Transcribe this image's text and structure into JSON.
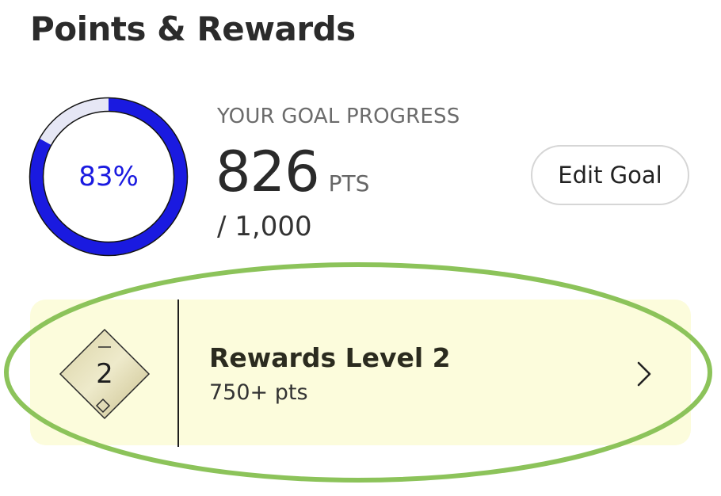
{
  "page": {
    "title": "Points & Rewards"
  },
  "goal": {
    "percent_label": "83%",
    "progress_fraction": 0.83,
    "label": "YOUR GOAL PROGRESS",
    "points": "826",
    "points_unit": "PTS",
    "target": "/  1,000",
    "edit_button_label": "Edit Goal"
  },
  "rewards": {
    "level_number": "2",
    "title": "Rewards Level 2",
    "subtitle": "750+ pts",
    "chevron_icon": "chevron-right-icon"
  },
  "colors": {
    "progress": "#1a1ae0",
    "progress_track": "#e6e7f5",
    "card_background": "#fcfcdc",
    "highlight": "#8cc35a"
  }
}
